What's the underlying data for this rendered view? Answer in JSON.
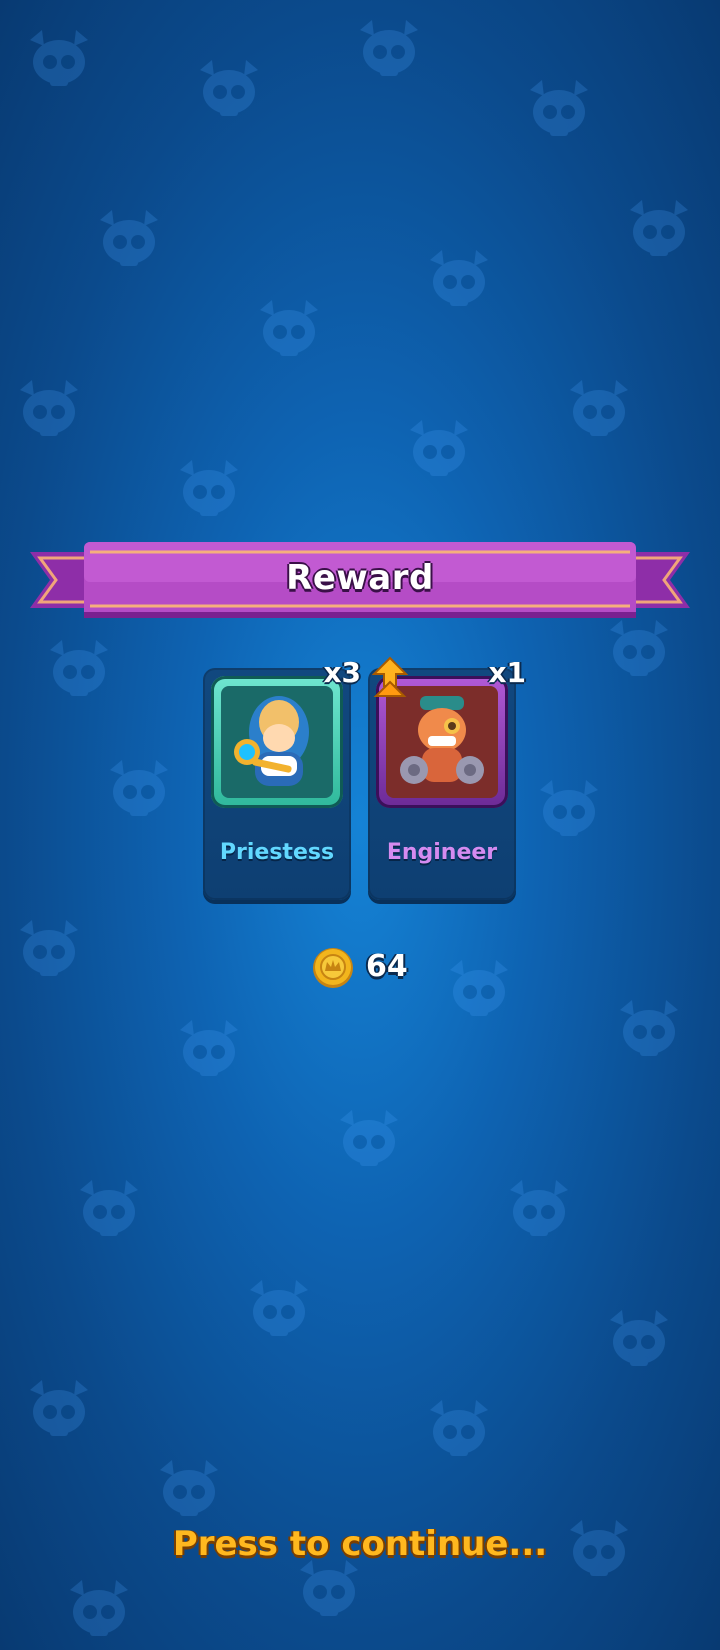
{
  "banner": {
    "title": "Reward"
  },
  "rewards": [
    {
      "name": "Priestess",
      "count": "x3"
    },
    {
      "name": "Engineer",
      "count": "x1"
    }
  ],
  "coins": {
    "value": "64"
  },
  "continue_prompt": "Press to continue...",
  "colors": {
    "banner": "#b03fbf",
    "priestess_name": "#62d8ff",
    "engineer_name": "#d58bf0",
    "continue_text": "#ffb81f",
    "coin": "#f2b51d"
  },
  "icons": {
    "background": "skull-helmet-icon",
    "upgrade": "upgrade-arrow-icon",
    "coin": "crown-coin-icon"
  }
}
